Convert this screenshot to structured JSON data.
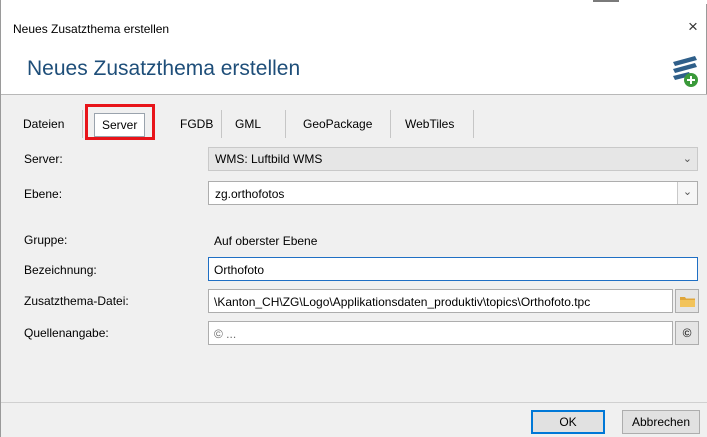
{
  "window": {
    "title": "Neues Zusatzthema erstellen",
    "close_glyph": "×"
  },
  "header": {
    "title": "Neues Zusatzthema erstellen",
    "icon": "add-layer-icon",
    "icon_color": "#2f5f8a",
    "plus_color": "#3a9a3a"
  },
  "tabs": [
    {
      "label": "Dateien",
      "selected": false
    },
    {
      "label": "Server",
      "selected": true
    },
    {
      "label": "FGDB",
      "selected": false
    },
    {
      "label": "GML",
      "selected": false
    },
    {
      "label": "GeoPackage",
      "selected": false
    },
    {
      "label": "WebTiles",
      "selected": false
    }
  ],
  "form": {
    "server": {
      "label": "Server:",
      "value": "WMS:  Luftbild WMS"
    },
    "ebene": {
      "label": "Ebene:",
      "value": "zg.orthofotos"
    },
    "gruppe": {
      "label": "Gruppe:",
      "value": "Auf oberster Ebene"
    },
    "bezeichnung": {
      "label": "Bezeichnung:",
      "value": "Orthofoto"
    },
    "datei": {
      "label": "Zusatzthema-Datei:",
      "value": "\\Kanton_CH\\ZG\\Logo\\Applikationsdaten_produktiv\\topics\\Orthofoto.tpc"
    },
    "quelle": {
      "label": "Quellenangabe:",
      "value": "© ..."
    }
  },
  "buttons": {
    "ok": "OK",
    "cancel": "Abbrechen",
    "copyright": "©"
  },
  "colors": {
    "accent_title": "#1e4e79",
    "highlight": "#e8141a",
    "focus": "#1f6fc4"
  }
}
